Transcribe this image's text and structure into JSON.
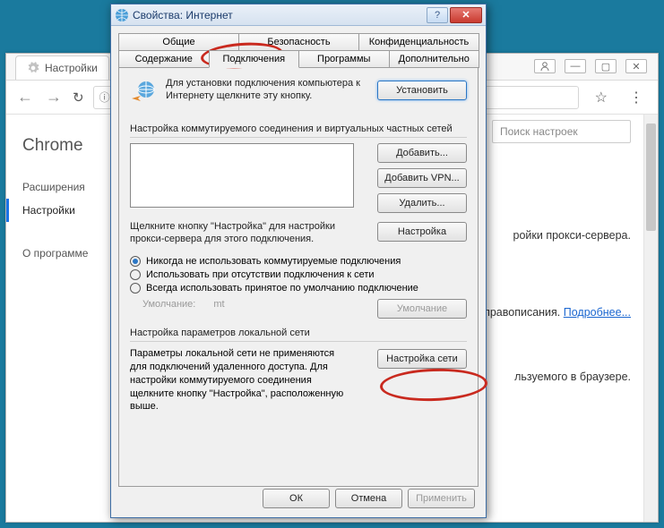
{
  "chrome": {
    "tab_label": "Настройки",
    "side_title": "Chrome",
    "side_items": [
      "Расширения",
      "Настройки",
      "О программе"
    ],
    "search_placeholder": "Поиск настроек",
    "line1": "ройки прокси-сервера.",
    "line2_a": "и правописания. ",
    "line2_link": "Подробнее...",
    "line3": "льзуемого в браузере."
  },
  "dialog": {
    "title": "Свойства: Интернет",
    "tabs_row1": [
      "Общие",
      "Безопасность",
      "Конфиденциальность"
    ],
    "tabs_row2": [
      "Содержание",
      "Подключения",
      "Программы",
      "Дополнительно"
    ],
    "intro": "Для установки подключения компьютера к Интернету щелкните эту кнопку.",
    "btn_setup": "Установить",
    "group_dialup": "Настройка коммутируемого соединения и виртуальных частных сетей",
    "btn_add": "Добавить...",
    "btn_add_vpn": "Добавить VPN...",
    "btn_remove": "Удалить...",
    "proxy_hint": "Щелкните кнопку \"Настройка\" для настройки прокси-сервера для этого подключения.",
    "btn_settings": "Настройка",
    "radio1": "Никогда не использовать коммутируемые подключения",
    "radio2": "Использовать при отсутствии подключения к сети",
    "radio3": "Всегда использовать принятое по умолчанию подключение",
    "default_label": "Умолчание:",
    "default_value": "mt",
    "btn_default": "Умолчание",
    "lan_title": "Настройка параметров локальной сети",
    "lan_text": "Параметры локальной сети не применяются для подключений удаленного доступа. Для настройки коммутируемого соединения щелкните кнопку \"Настройка\", расположенную выше.",
    "btn_lan": "Настройка сети",
    "btn_ok": "ОК",
    "btn_cancel": "Отмена",
    "btn_apply": "Применить"
  }
}
